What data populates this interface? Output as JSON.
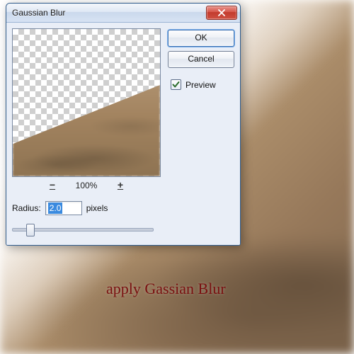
{
  "dialog": {
    "title": "Gaussian Blur",
    "ok_label": "OK",
    "cancel_label": "Cancel",
    "preview_label": "Preview",
    "preview_checked": true,
    "zoom": {
      "minus": "−",
      "label": "100%",
      "plus": "+"
    },
    "radius": {
      "label": "Radius:",
      "value": "2.0",
      "unit": "pixels"
    }
  },
  "annotation": "apply Gassian Blur"
}
